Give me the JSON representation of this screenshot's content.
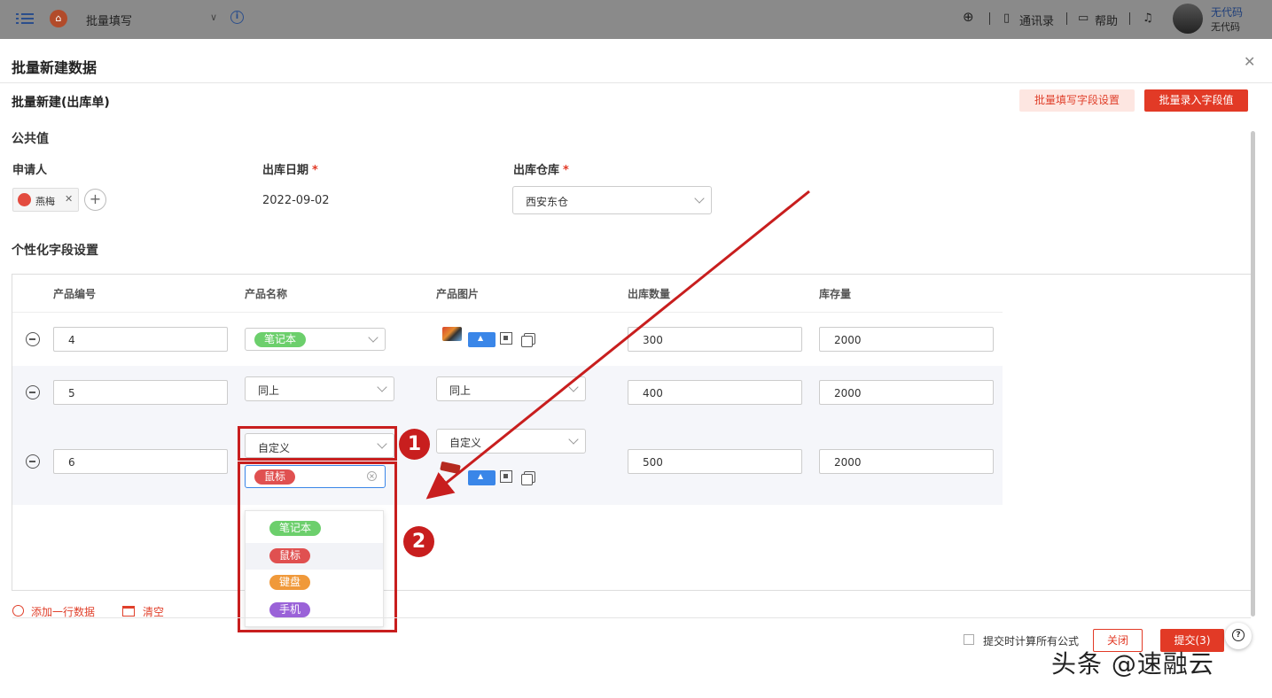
{
  "topbar": {
    "app_title": "批量填写",
    "contacts": "通讯录",
    "help": "帮助",
    "user_name": "无代码",
    "user_org": "无代码"
  },
  "modal": {
    "title": "批量新建数据",
    "subtitle": "批量新建(出库单)",
    "batch_settings_button": "批量填写字段设置",
    "batch_input_button": "批量录入字段值"
  },
  "public": {
    "section_title": "公共值",
    "applicant_label": "申请人",
    "applicant_value": "燕梅",
    "date_label": "出库日期",
    "date_value": "2022-09-02",
    "warehouse_label": "出库仓库",
    "warehouse_value": "西安东仓",
    "required_mark": "*"
  },
  "custom": {
    "section_title": "个性化字段设置",
    "columns": [
      "产品编号",
      "产品名称",
      "产品图片",
      "出库数量",
      "库存量"
    ],
    "rows": [
      {
        "code": "4",
        "name_tag": "笔记本",
        "name_color": "#6ccf6c",
        "qty": "300",
        "stock": "2000"
      },
      {
        "code": "5",
        "name_select": "同上",
        "image_select": "同上",
        "qty": "400",
        "stock": "2000"
      },
      {
        "code": "6",
        "name_select": "自定义",
        "name_tag": "鼠标",
        "name_color": "#e05050",
        "image_select": "自定义",
        "qty": "500",
        "stock": "2000"
      }
    ]
  },
  "dropdown": {
    "options": [
      {
        "label": "笔记本",
        "color": "#6ccf6c"
      },
      {
        "label": "鼠标",
        "color": "#e05050"
      },
      {
        "label": "键盘",
        "color": "#f0993a"
      },
      {
        "label": "手机",
        "color": "#9a62d8"
      }
    ]
  },
  "annotations": {
    "badge_1": "1",
    "badge_2": "2"
  },
  "footer": {
    "add_row": "添加一行数据",
    "clear": "清空",
    "calc_label": "提交时计算所有公式",
    "close_button": "关闭",
    "submit_button": "提交(3)"
  },
  "watermark": "头条 @速融云"
}
